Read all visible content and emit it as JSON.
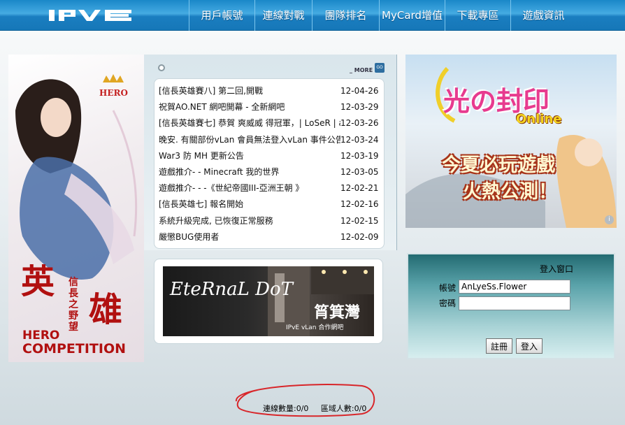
{
  "header": {
    "logo_text": "IPVE",
    "nav": [
      {
        "label": "用戶帳號",
        "icon": ""
      },
      {
        "label": "連線對戰"
      },
      {
        "label": "團隊排名"
      },
      {
        "label": "MyCard增值"
      },
      {
        "label": "下載專區"
      },
      {
        "label": "遊戲資訊"
      }
    ]
  },
  "left_banner": {
    "badge": "HERO",
    "big1": "英",
    "big2": "雄",
    "sub": "信長之野望",
    "comp1": "HERO",
    "comp2": "COMPETITION"
  },
  "news": {
    "more_label": "MORE",
    "go_label": "GO",
    "items": [
      {
        "title": "[信長英雄賽八] 第二回,開戰",
        "date": "12-04-26"
      },
      {
        "title": "祝賀AO.NET 網吧開幕 - 全新網吧",
        "date": "12-03-29"
      },
      {
        "title": "[信長英雄賽七] 恭賀 爽威威 得冠軍，| LoSeR | a",
        "date": "12-03-26"
      },
      {
        "title": "晚安. 有關部份vLan 會員無法登入vLan 事件公告",
        "date": "12-03-24"
      },
      {
        "title": "War3 防 MH 更新公告",
        "date": "12-03-19"
      },
      {
        "title": "遊戲推介- - Minecraft 我的世界",
        "date": "12-03-05"
      },
      {
        "title": "遊戲推介- - -《世紀帝國III-亞洲王朝 》",
        "date": "12-02-21"
      },
      {
        "title": "[信長英雄七] 報名開始",
        "date": "12-02-16"
      },
      {
        "title": "系統升級完成, 已恢復正常服務",
        "date": "12-02-15"
      },
      {
        "title": "嚴懲BUG使用者",
        "date": "12-02-09"
      }
    ]
  },
  "partner": {
    "logo": "EteRnaL DoT",
    "name": "筲箕灣",
    "sub": "IPvE vLan 合作網吧"
  },
  "ad": {
    "title": "光の封印",
    "online": "Online",
    "line1": "今夏必玩遊戲",
    "line2": "火熱公測！",
    "info": "i"
  },
  "login": {
    "title": "登入窗口",
    "account_label": "帳號",
    "password_label": "密碼",
    "account_value": "AnLyeSs.Flower",
    "password_value": "",
    "register_label": "註冊",
    "login_label": "登入"
  },
  "footer": {
    "connections": "連線數量:0/0",
    "area_users": "區域人數:0/0"
  },
  "colors": {
    "nav_bg": "#1a87c8",
    "login_top": "#236b72",
    "annotation": "#d8262a"
  }
}
